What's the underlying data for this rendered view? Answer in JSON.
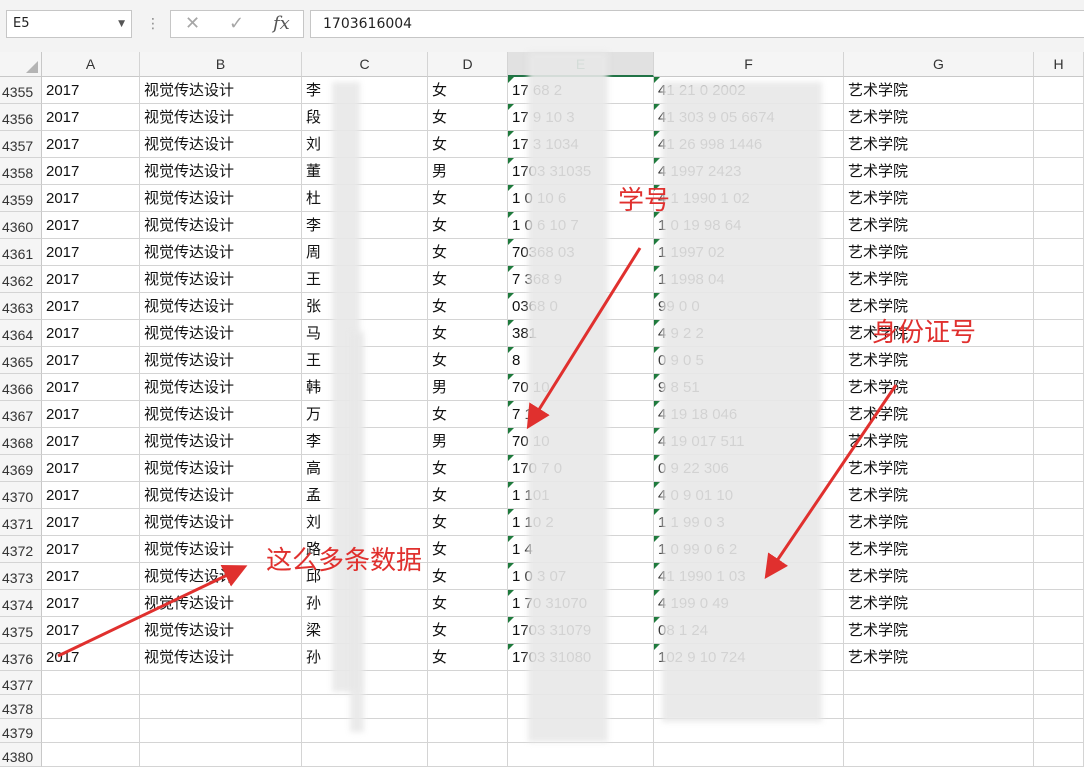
{
  "formula_bar": {
    "name_box": "E5",
    "cancel_icon": "✕",
    "enter_icon": "✓",
    "fx_label": "fx",
    "value": "1703616004"
  },
  "columns": [
    "A",
    "B",
    "C",
    "D",
    "E",
    "F",
    "G",
    "H"
  ],
  "rows": [
    {
      "n": "4355",
      "a": "2017",
      "b": "视觉传达设计",
      "c": "李",
      "d": "女",
      "e": "17  68   2",
      "f": "41    21     0   2002",
      "g": "艺术学院"
    },
    {
      "n": "4356",
      "a": "2017",
      "b": "视觉传达设计",
      "c": "段",
      "d": "女",
      "e": "17   9 10 3",
      "f": "41 303    9 05 6674",
      "g": "艺术学院"
    },
    {
      "n": "4357",
      "a": "2017",
      "b": "视觉传达设计",
      "c": "刘",
      "d": "女",
      "e": "17   3  1034",
      "f": "41  26   998  1446",
      "g": "艺术学院"
    },
    {
      "n": "4358",
      "a": "2017",
      "b": "视觉传达设计",
      "c": "董",
      "d": "男",
      "e": "1703   31035",
      "f": "4   1997   2423",
      "g": "艺术学院"
    },
    {
      "n": "4359",
      "a": "2017",
      "b": "视觉传达设计",
      "c": "杜",
      "d": "女",
      "e": "1   0   10 6",
      "f": "4   1   1990  1 02",
      "g": "艺术学院"
    },
    {
      "n": "4360",
      "a": "2017",
      "b": "视觉传达设计",
      "c": "李",
      "d": "女",
      "e": "1  0 6 10 7",
      "f": "1  0   19 98   64",
      "g": "艺术学院"
    },
    {
      "n": "4361",
      "a": "2017",
      "b": "视觉传达设计",
      "c": "周",
      "d": "女",
      "e": "  70368  03",
      "f": "1    1997   02",
      "g": "艺术学院"
    },
    {
      "n": "4362",
      "a": "2017",
      "b": "视觉传达设计",
      "c": "王",
      "d": "女",
      "e": "  7 368  9",
      "f": "   1  1998   04",
      "g": "艺术学院"
    },
    {
      "n": "4363",
      "a": "2017",
      "b": "视觉传达设计",
      "c": "张",
      "d": "女",
      "e": "   0368 0",
      "f": "      99     0 0",
      "g": "艺术学院"
    },
    {
      "n": "4364",
      "a": "2017",
      "b": "视觉传达设计",
      "c": "马",
      "d": "女",
      "e": "   381",
      "f": "4     9      2 2",
      "g": "艺术学院"
    },
    {
      "n": "4365",
      "a": "2017",
      "b": "视觉传达设计",
      "c": "王",
      "d": "女",
      "e": "   8",
      "f": "  0    9    0 5",
      "g": "艺术学院"
    },
    {
      "n": "4366",
      "a": "2017",
      "b": "视觉传达设计",
      "c": "韩",
      "d": "男",
      "e": "70   10",
      "f": "       9     8 51",
      "g": "艺术学院"
    },
    {
      "n": "4367",
      "a": "2017",
      "b": "视觉传达设计",
      "c": "万",
      "d": "女",
      "e": "7    10",
      "f": "4    19     18 046",
      "g": "艺术学院"
    },
    {
      "n": "4368",
      "a": "2017",
      "b": "视觉传达设计",
      "c": "李",
      "d": "男",
      "e": "70   10",
      "f": "4    19    017 511",
      "g": "艺术学院"
    },
    {
      "n": "4369",
      "a": "2017",
      "b": "视觉传达设计",
      "c": "高",
      "d": "女",
      "e": "170  7 0",
      "f": "    0   9    22 306",
      "g": "艺术学院"
    },
    {
      "n": "4370",
      "a": "2017",
      "b": "视觉传达设计",
      "c": "孟",
      "d": "女",
      "e": "1    101",
      "f": "4  0    9   01 10",
      "g": "艺术学院"
    },
    {
      "n": "4371",
      "a": "2017",
      "b": "视觉传达设计",
      "c": "刘",
      "d": "女",
      "e": "1     10 2",
      "f": "1  1   99  0 3",
      "g": "艺术学院"
    },
    {
      "n": "4372",
      "a": "2017",
      "b": "视觉传达设计",
      "c": "路",
      "d": "女",
      "e": "1       4",
      "f": "1 0    99  0   6 2",
      "g": "艺术学院"
    },
    {
      "n": "4373",
      "a": "2017",
      "b": "视觉传达设计",
      "c": "邱",
      "d": "女",
      "e": "1   0   3 07",
      "f": "41     1990    1 03",
      "g": "艺术学院"
    },
    {
      "n": "4374",
      "a": "2017",
      "b": "视觉传达设计",
      "c": "孙",
      "d": "女",
      "e": "1 70  31070",
      "f": "4    199 0    49",
      "g": "艺术学院"
    },
    {
      "n": "4375",
      "a": "2017",
      "b": "视觉传达设计",
      "c": "梁",
      "d": "女",
      "e": "1703  31079",
      "f": "  08  1       24",
      "g": "艺术学院"
    },
    {
      "n": "4376",
      "a": "2017",
      "b": "视觉传达设计",
      "c": "孙",
      "d": "女",
      "e": "1703  31080",
      "f": "102    9   10  724",
      "g": "艺术学院"
    },
    {
      "n": "4377",
      "a": "",
      "b": "",
      "c": "",
      "d": "",
      "e": "",
      "f": "",
      "g": ""
    },
    {
      "n": "4378",
      "a": "",
      "b": "",
      "c": "",
      "d": "",
      "e": "",
      "f": "",
      "g": ""
    },
    {
      "n": "4379",
      "a": "",
      "b": "",
      "c": "",
      "d": "",
      "e": "",
      "f": "",
      "g": ""
    },
    {
      "n": "4380",
      "a": "",
      "b": "",
      "c": "",
      "d": "",
      "e": "",
      "f": "",
      "g": ""
    }
  ],
  "annotations": {
    "student_id": "学号",
    "id_card": "身份证号",
    "many_records": "这么多条数据"
  },
  "colors": {
    "annotation": "#e0302e",
    "selected_header": "#217346"
  }
}
